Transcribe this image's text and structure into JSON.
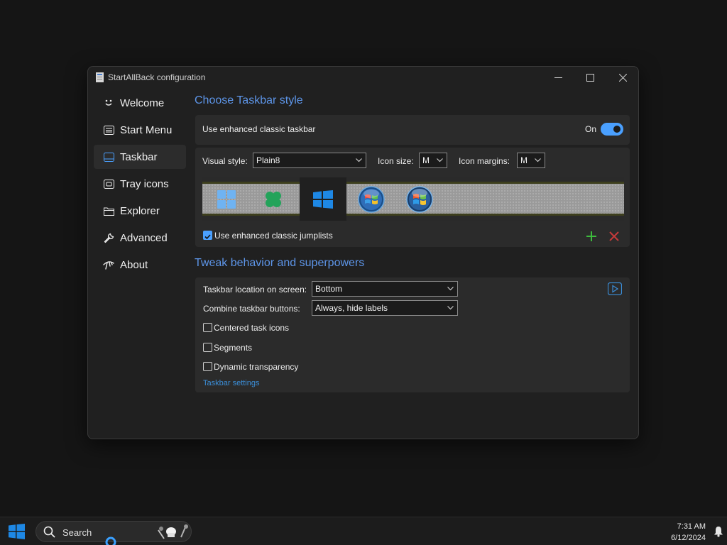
{
  "window": {
    "title": "StartAllBack configuration"
  },
  "sidebar": {
    "items": [
      {
        "label": "Welcome",
        "icon": "smile-icon"
      },
      {
        "label": "Start Menu",
        "icon": "start-menu-icon"
      },
      {
        "label": "Taskbar",
        "icon": "taskbar-icon",
        "active": true
      },
      {
        "label": "Tray icons",
        "icon": "tray-icon"
      },
      {
        "label": "Explorer",
        "icon": "folder-icon"
      },
      {
        "label": "Advanced",
        "icon": "wrench-icon"
      },
      {
        "label": "About",
        "icon": "about-icon"
      }
    ]
  },
  "taskbar_style": {
    "section_title": "Choose Taskbar style",
    "enhanced_label": "Use enhanced classic taskbar",
    "enhanced_state": "On",
    "visual_style_label": "Visual style:",
    "visual_style_value": "Plain8",
    "icon_size_label": "Icon size:",
    "icon_size_value": "M",
    "icon_margins_label": "Icon margins:",
    "icon_margins_value": "M",
    "jumplists_label": "Use enhanced classic jumplists",
    "styles": [
      {
        "name": "windows-11-style",
        "icon": "win11-logo-icon"
      },
      {
        "name": "windows-8-style",
        "icon": "clover-icon"
      },
      {
        "name": "windows-10-style",
        "icon": "win10-logo-icon",
        "selected": true
      },
      {
        "name": "windows-7-style",
        "icon": "win7-orb-icon"
      },
      {
        "name": "windows-vista-style",
        "icon": "vista-orb-icon"
      }
    ],
    "colors": {
      "accent": "#4aa0ff",
      "title": "#5d95e8"
    }
  },
  "behavior": {
    "section_title": "Tweak behavior and superpowers",
    "location_label": "Taskbar location on screen:",
    "location_value": "Bottom",
    "combine_label": "Combine taskbar buttons:",
    "combine_value": "Always, hide labels",
    "centered_label": "Centered task icons",
    "segments_label": "Segments",
    "transparency_label": "Dynamic transparency",
    "settings_link": "Taskbar settings"
  },
  "os_taskbar": {
    "search_placeholder": "Search",
    "time": "7:31 AM",
    "date": "6/12/2024"
  }
}
